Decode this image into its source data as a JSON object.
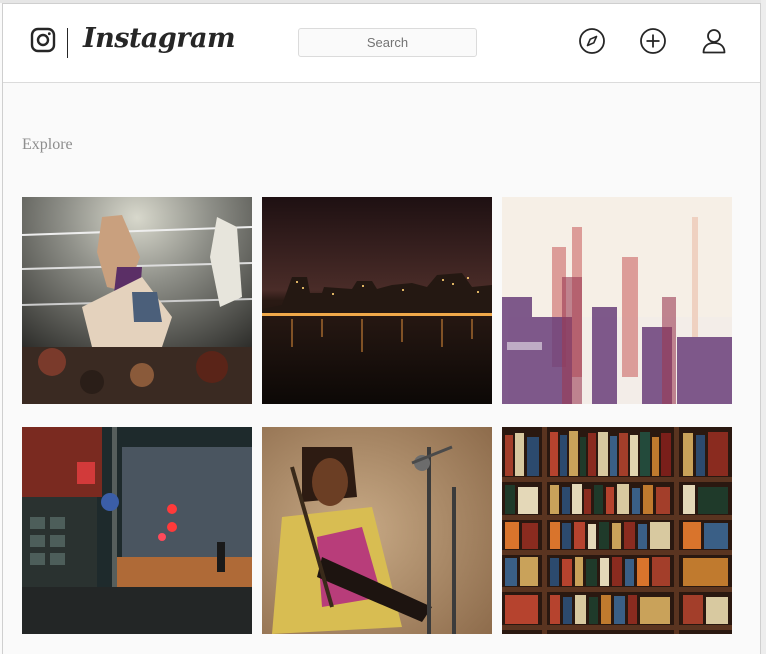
{
  "header": {
    "brand": "Instagram",
    "search": {
      "placeholder": "Search"
    },
    "nav": [
      {
        "name": "explore",
        "icon": "compass-icon"
      },
      {
        "name": "new-post",
        "icon": "plus-circle-icon"
      },
      {
        "name": "profile",
        "icon": "user-icon"
      }
    ]
  },
  "main": {
    "title": "Explore",
    "posts": [
      {
        "subject": "painting of boxers fighting in a ring"
      },
      {
        "subject": "city skyline reflected on water at night"
      },
      {
        "subject": "abstract purple and red city skyline"
      },
      {
        "subject": "neon-lit street corner at night"
      },
      {
        "subject": "guitarist performing at a microphone"
      },
      {
        "subject": "bookshelf filled with books"
      }
    ]
  },
  "colors": {
    "text": "#262626",
    "muted": "#8e8e8e",
    "border": "#dbdbdb",
    "background": "#fafafa"
  }
}
